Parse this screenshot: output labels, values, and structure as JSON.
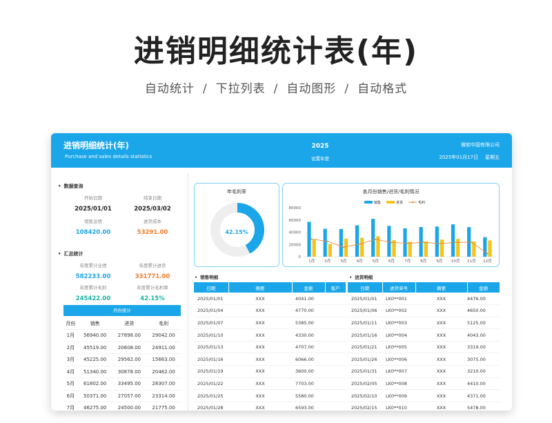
{
  "hero": {
    "title": "进销明细统计表(年)",
    "features": [
      "自动统计",
      "下拉列表",
      "自动图形",
      "自动格式"
    ],
    "separator": "/"
  },
  "header": {
    "title": "进销明细统计(年)",
    "subtitle": "Purchase and sales details statistics",
    "year": "2025",
    "year_label": "设置年度",
    "company": "微软中国有限公司",
    "date": "2025年01月17日",
    "weekday": "星期五"
  },
  "query": {
    "section": "数据查询",
    "start_label": "开始日期",
    "start_value": "2025/01/01",
    "end_label": "结束日期",
    "end_value": "2025/03/02",
    "sales_label": "销售业绩",
    "sales_value": "108420.00",
    "cost_label": "进货成本",
    "cost_value": "53291.00"
  },
  "summary": {
    "section": "汇总统计",
    "annual_sales_label": "年度累计业绩",
    "annual_sales_value": "582233.00",
    "annual_purchase_label": "年度累计进货",
    "annual_purchase_value": "331771.00",
    "annual_profit_label": "年度累计毛利",
    "annual_profit_value": "245422.00",
    "annual_margin_label": "年度累计毛利率",
    "annual_margin_value": "42.15%"
  },
  "monthly": {
    "title": "月份统计",
    "columns": [
      "月份",
      "销售",
      "进货",
      "毛利"
    ],
    "rows": [
      [
        "1月",
        "56940.00",
        "27898.00",
        "29042.00"
      ],
      [
        "2月",
        "45519.00",
        "20608.00",
        "24911.00"
      ],
      [
        "3月",
        "45225.00",
        "29562.00",
        "15663.00"
      ],
      [
        "4月",
        "51340.00",
        "30878.00",
        "20462.00"
      ],
      [
        "5月",
        "61802.00",
        "33495.00",
        "28307.00"
      ],
      [
        "6月",
        "50371.00",
        "27057.00",
        "23314.00"
      ],
      [
        "7月",
        "46275.00",
        "24500.00",
        "21775.00"
      ]
    ]
  },
  "donut": {
    "title": "年毛利率",
    "value_text": "42.15%",
    "fraction": 0.4215,
    "color": "#1aa6e8",
    "track_color": "#eeeeee"
  },
  "chart_data": {
    "type": "bar",
    "title": "各月份销售/进货/毛利情况",
    "categories": [
      "1月",
      "2月",
      "3月",
      "4月",
      "5月",
      "6月",
      "7月",
      "8月",
      "9月",
      "10月",
      "11月",
      "12月"
    ],
    "series": [
      {
        "name": "销售",
        "type": "bar",
        "color": "#1aa6e8",
        "values": [
          56940,
          45519,
          45225,
          51340,
          61802,
          50371,
          46275,
          48500,
          49200,
          52800,
          48300,
          31900
        ]
      },
      {
        "name": "进货",
        "type": "bar",
        "color": "#f7c21a",
        "values": [
          27898,
          20608,
          29562,
          30878,
          33495,
          27057,
          24500,
          25000,
          28000,
          29200,
          24800,
          26500
        ]
      },
      {
        "name": "毛利",
        "type": "line",
        "color": "#f08a3c",
        "values": [
          29042,
          24911,
          15663,
          20462,
          28307,
          23314,
          21775,
          23500,
          21200,
          23600,
          23500,
          5400
        ]
      }
    ],
    "yticks": [
      0,
      20000,
      40000,
      60000,
      80000
    ],
    "ylim": [
      0,
      80000
    ],
    "legend": "top",
    "grid": false
  },
  "sales_table": {
    "title": "销售明细",
    "columns": [
      "日期",
      "摘要",
      "金额",
      "客户"
    ],
    "rows": [
      [
        "2025/01/01",
        "XXX",
        "4041.00",
        ""
      ],
      [
        "2025/01/04",
        "XXX",
        "4770.00",
        ""
      ],
      [
        "2025/01/07",
        "XXX",
        "5385.00",
        ""
      ],
      [
        "2025/01/10",
        "XXX",
        "4330.00",
        ""
      ],
      [
        "2025/01/13",
        "XXX",
        "4707.00",
        ""
      ],
      [
        "2025/01/16",
        "XXX",
        "6066.00",
        ""
      ],
      [
        "2025/01/19",
        "XXX",
        "3600.00",
        ""
      ],
      [
        "2025/01/22",
        "XXX",
        "7703.00",
        ""
      ],
      [
        "2025/01/25",
        "XXX",
        "5580.00",
        ""
      ],
      [
        "2025/01/28",
        "XXX",
        "6593.00",
        ""
      ]
    ]
  },
  "purchase_table": {
    "title": "进货明细",
    "columns": [
      "日期",
      "进货单号",
      "摘要",
      "金额"
    ],
    "rows": [
      [
        "2025/01/01",
        "LK0**001",
        "XXX",
        "4476.00"
      ],
      [
        "2025/01/06",
        "LK0**002",
        "XXX",
        "4650.00"
      ],
      [
        "2025/01/11",
        "LK0**003",
        "XXX",
        "5125.00"
      ],
      [
        "2025/01/16",
        "LK0**004",
        "XXX",
        "4043.00"
      ],
      [
        "2025/01/21",
        "LK0**005",
        "XXX",
        "3319.00"
      ],
      [
        "2025/01/26",
        "LK0**006",
        "XXX",
        "3075.00"
      ],
      [
        "2025/01/31",
        "LK0**007",
        "XXX",
        "3210.00"
      ],
      [
        "2025/02/05",
        "LK0**008",
        "XXX",
        "4410.00"
      ],
      [
        "2025/02/10",
        "LK0**009",
        "XXX",
        "4371.00"
      ],
      [
        "2025/02/15",
        "LK0**010",
        "XXX",
        "5478.00"
      ]
    ]
  }
}
